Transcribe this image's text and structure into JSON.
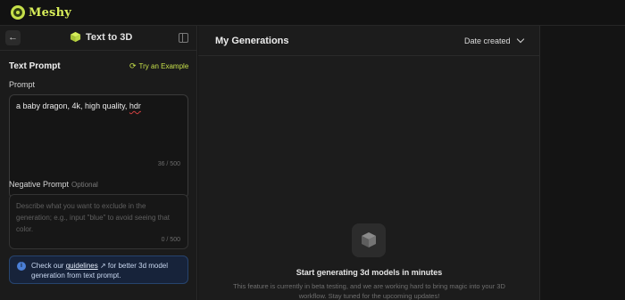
{
  "app": {
    "name": "Meshy"
  },
  "sidebar": {
    "mode_title": "Text to 3D",
    "section_title": "Text Prompt",
    "try_example": "Try an Example",
    "prompt": {
      "label": "Prompt",
      "value": "a baby dragon, 4k, high quality, ",
      "value_flagged": "hdr",
      "counter": "36 / 500"
    },
    "negative_prompt": {
      "label": "Negative Prompt",
      "optional": "Optional",
      "placeholder": "Describe what you want to exclude in the generation; e.g., input \"blue\" to avoid seeing that color.",
      "counter": "0 / 500"
    },
    "info": {
      "before": "Check our ",
      "link": "guidelines",
      "link_icon": "↗",
      "after": " for better 3d model generation from text prompt."
    }
  },
  "main": {
    "title": "My Generations",
    "sort": "Date created",
    "empty": {
      "title": "Start generating 3d models in minutes",
      "description": "This feature is currently in beta testing, and we are working hard to bring magic into your 3D workflow. Stay tuned for the upcoming updates!"
    }
  },
  "colors": {
    "accent": "#c6e04a",
    "info": "#4b7fd6"
  }
}
